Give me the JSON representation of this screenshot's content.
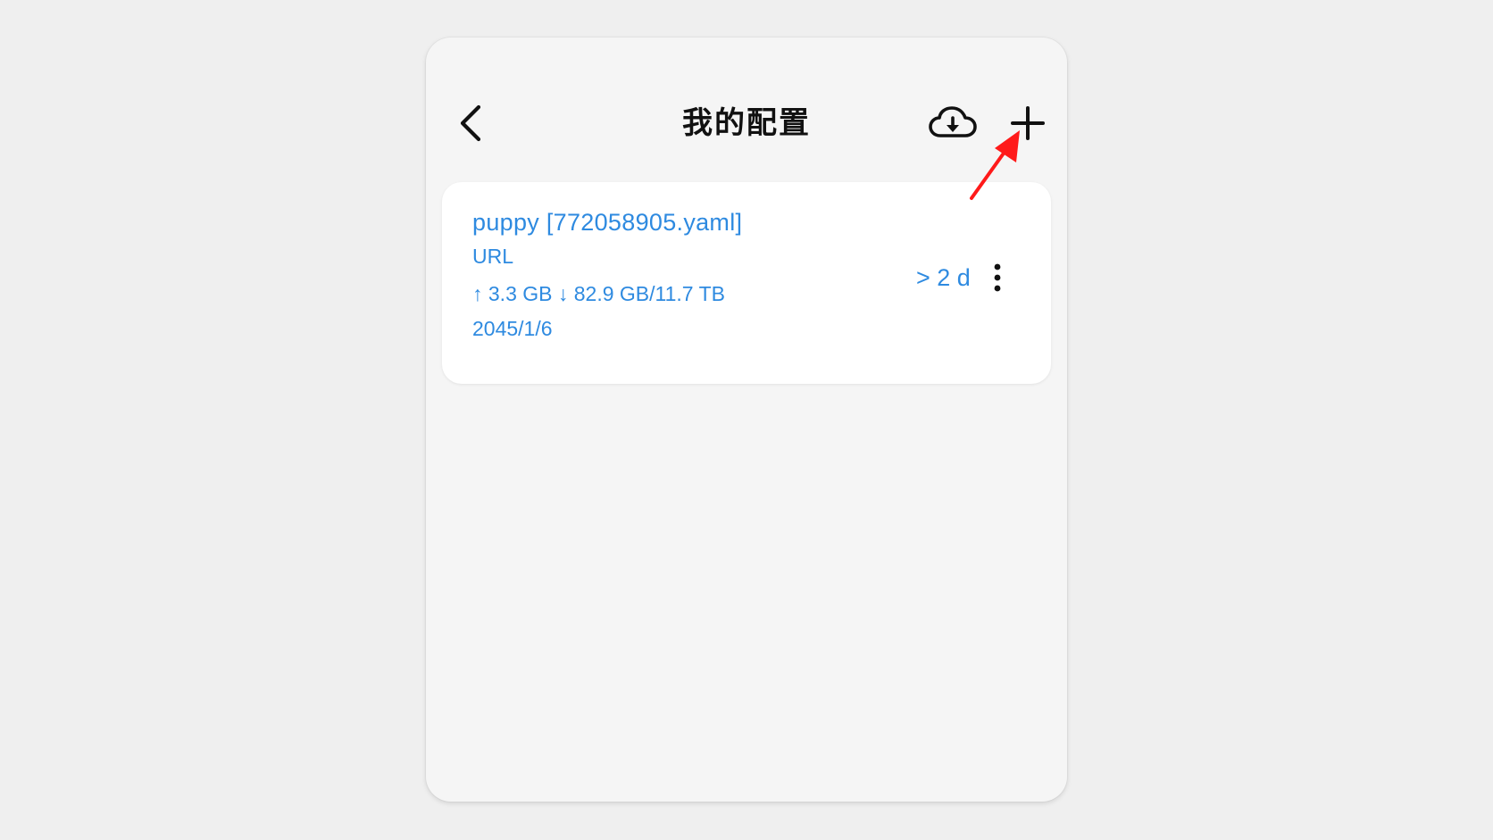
{
  "header": {
    "title": "我的配置",
    "back_icon": "chevron-left-icon",
    "import_icon": "cloud-download-icon",
    "add_icon": "plus-icon"
  },
  "profiles": [
    {
      "name": "puppy [772058905.yaml]",
      "type": "URL",
      "traffic": "↑ 3.3 GB ↓ 82.9 GB/11.7 TB",
      "expiry": "2045/1/6",
      "updated": "> 2 d",
      "menu_icon": "more-vertical-icon"
    }
  ],
  "colors": {
    "accent": "#2e8ae0",
    "annotation": "#ff1a1a",
    "background": "#efefef",
    "panel": "#f5f5f5",
    "card": "#ffffff"
  }
}
